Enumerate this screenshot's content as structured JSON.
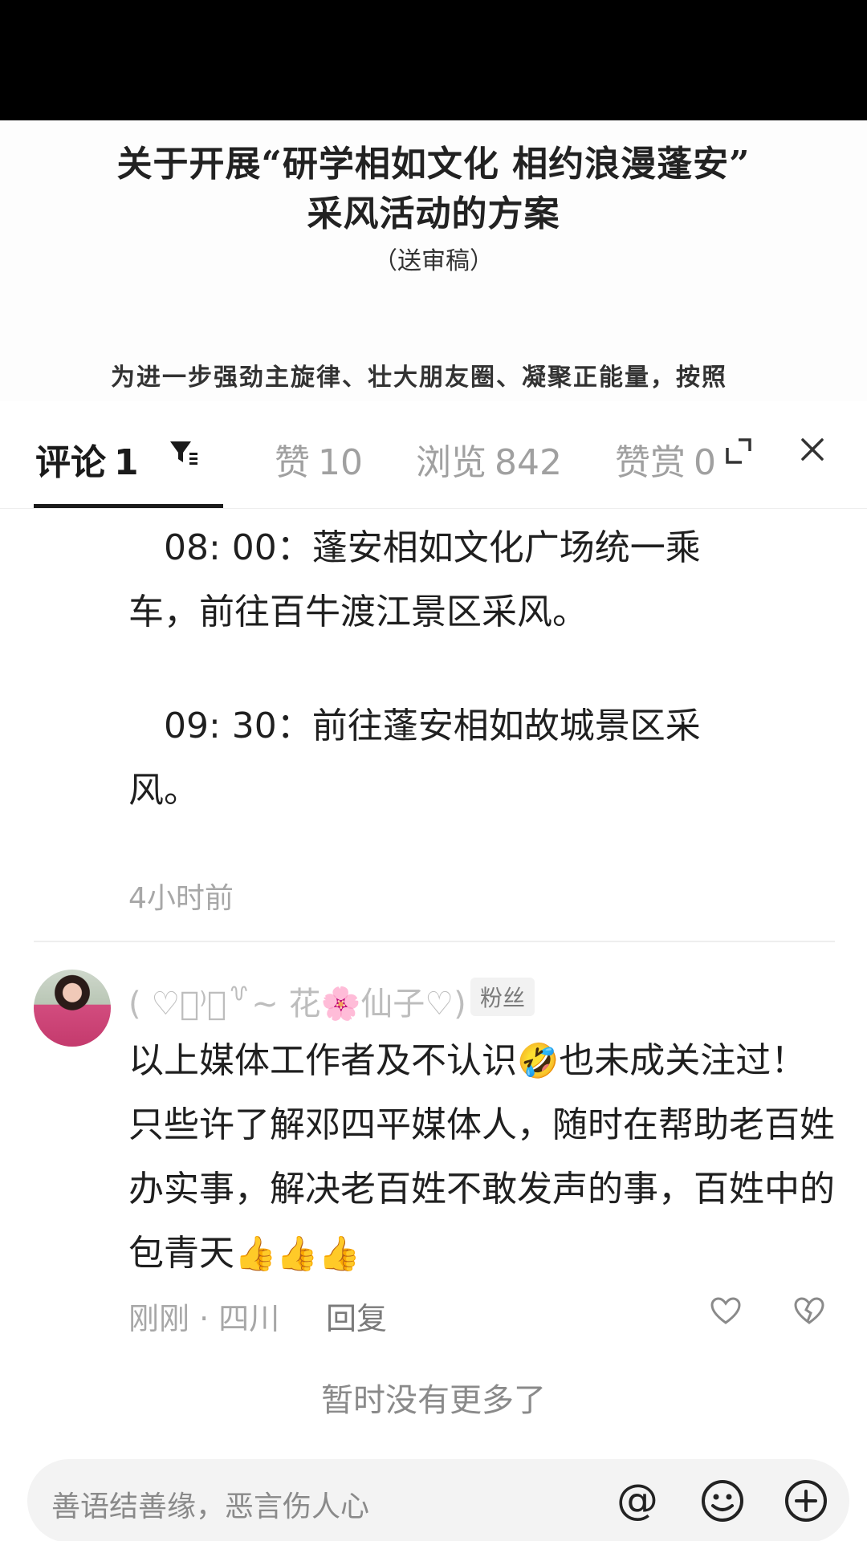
{
  "document": {
    "title_line1": "关于开展“研学相如文化 相约浪漫蓬安”",
    "title_line2": "采风活动的方案",
    "subtitle": "（送审稿）",
    "body_line": "为进一步强劲主旋律、壮大朋友圈、凝聚正能量，按照"
  },
  "tabs": [
    {
      "label": "评论",
      "count": "1"
    },
    {
      "label": "赞",
      "count": "10"
    },
    {
      "label": "浏览",
      "count": "842"
    },
    {
      "label": "赞赏",
      "count": "0"
    }
  ],
  "icons": {
    "filter": "filter-icon",
    "expand": "expand-icon",
    "close": "close-icon",
    "like": "heart-icon",
    "dislike": "broken-heart-icon",
    "mention": "at-icon",
    "emoji": "smile-icon",
    "add": "plus-circle-icon"
  },
  "comment1": {
    "line1": "　08: 00：蓬安相如文化广场统一乘",
    "line2": "车，前往百牛渡江景区采风。",
    "line3": "　09: 30：前往蓬安相如故城景区采",
    "line4": "风。",
    "time": "4小时前"
  },
  "comment2": {
    "username": "( ♡͙⁾ཾ꒷~ 花🌸仙子♡)",
    "badge": "粉丝",
    "text_a": "以上媒体工作者及不认识",
    "emoji_a": "🤣",
    "text_b": "也未成关注过！只些许了解邓四平媒体人，随时在帮助老百姓办实事，解决老百姓不敢发声的事，百姓中的包青天",
    "emoji_b": "👍👍👍",
    "meta": "刚刚 · 四川",
    "reply": "回复"
  },
  "footer": {
    "no_more": "暂时没有更多了",
    "input_placeholder": "善语结善缘，恶言伤人心"
  }
}
